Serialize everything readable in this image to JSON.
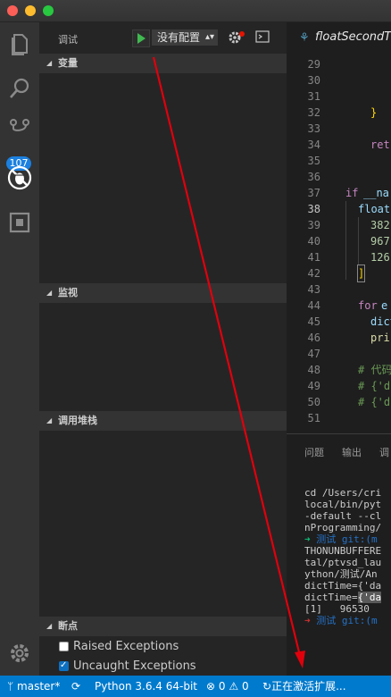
{
  "window": {
    "traffic_lights": [
      "close",
      "minimize",
      "zoom"
    ]
  },
  "activity_bar": {
    "items": [
      {
        "icon": "files-icon"
      },
      {
        "icon": "search-icon"
      },
      {
        "icon": "source-control-icon",
        "badge": "107"
      },
      {
        "icon": "debug-icon",
        "active": true
      },
      {
        "icon": "extensions-icon"
      }
    ],
    "settings_icon": "gear-icon"
  },
  "debug": {
    "title": "调试",
    "config_select": "没有配置",
    "sections": {
      "variables": "变量",
      "watch": "监视",
      "call_stack": "调用堆栈",
      "breakpoints": "断点"
    },
    "breakpoints": [
      {
        "label": "Raised Exceptions",
        "checked": false
      },
      {
        "label": "Uncaught Exceptions",
        "checked": true
      }
    ]
  },
  "editor": {
    "tab_name": "floatSecondT",
    "line_numbers": [
      "29",
      "30",
      "31",
      "32",
      "33",
      "34",
      "35",
      "36",
      "37",
      "38",
      "39",
      "40",
      "41",
      "42",
      "43",
      "44",
      "45",
      "46",
      "47",
      "48",
      "49",
      "50",
      "51"
    ],
    "current_line": "38",
    "code": {
      "l32": "}",
      "l34": "ret",
      "l37a": "if",
      "l37b": "__na",
      "l38": "float",
      "l39": "382",
      "l40": "967",
      "l41": "126",
      "l42": "]",
      "l44a": "for",
      "l44b": "e",
      "l45": "dict",
      "l46": "pri",
      "l48": "# 代码",
      "l49": "# {'d",
      "l50": "# {'d"
    }
  },
  "panel": {
    "tabs": [
      "问题",
      "输出",
      "调"
    ],
    "terminal_lines": [
      "cd /Users/cri",
      "local/bin/pyt",
      "-default --cl",
      "nProgramming/",
      "THONUNBUFFERE",
      "tal/ptvsd_lau",
      "ython/测试/An",
      "dictTime={'da",
      "dictTime=",
      "{'da",
      "[1]   96530 ",
      "测试",
      "git:(m"
    ],
    "prompt_arrow": "➜"
  },
  "status_bar": {
    "branch": "master*",
    "python": "Python 3.6.4 64-bit",
    "errors": "0",
    "warnings": "0",
    "activity": "正在激活扩展..."
  },
  "colors": {
    "status_bar": "#007acc",
    "badge": "#1b80e0",
    "annotation_arrow": "#e0000c"
  }
}
